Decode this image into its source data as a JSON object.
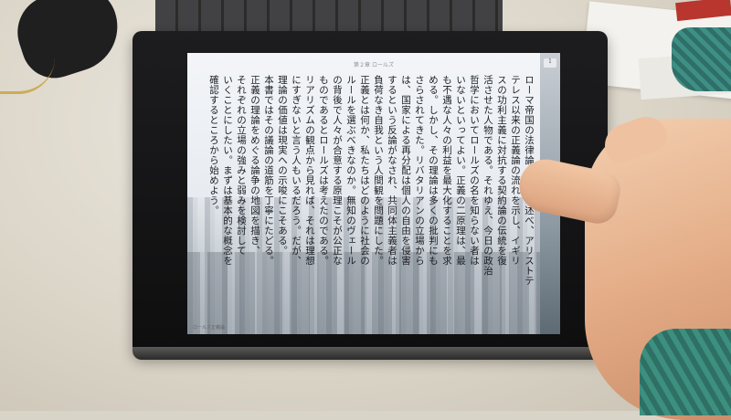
{
  "scene": {
    "description_objects": [
      "tablet",
      "keyboard",
      "mouse",
      "hand"
    ]
  },
  "tablet": {
    "header": "第２章 ロールズ",
    "page_counter": "1",
    "footer": "ロールズ正義論",
    "columns": [
      "ローマ帝国の法律論の歴史を述べ、アリストテ",
      "テレス以来の正義論の流れを示し、イギリ",
      "スの功利主義に対抗する契約論の伝統を復",
      "活させた人物である。それゆえ、今日の政治",
      "哲学においてロールズの名を知らない者は",
      "いないといってよい。正義の二原理は、最",
      "も不遇な人々の利益を最大化することを求",
      "める。しかし、その理論は多くの批判にも",
      "さらされてきた。リバタリアンの立場から",
      "は、国家による再分配は個人の自由を侵害",
      "するという反論がなされ、共同体主義者は",
      "負荷なき自我という人間観を問題にした。",
      "正義とは何か、私たちはどのように社会の",
      "ルールを選ぶべきなのか。無知のヴェール",
      "の背後で人々が合意する原理こそが公正な",
      "ものであるとロールズは考えたのである。",
      "リアリズムの観点から見れば、それは理想",
      "にすぎないと言う人もいるだろう。だが、",
      "理論の価値は現実への示唆にこそある。",
      "本書ではその議論の道筋を丁寧にたどる。",
      "正義の理論をめぐる論争の地図を描き、",
      "それぞれの立場の強みと弱みを検討して",
      "いくことにしたい。まずは基本的な概念を",
      "確認するところから始めよう。"
    ]
  },
  "colors": {
    "screen_bg": "#eef1f5",
    "text": "#1c1f24",
    "bezel": "#141415",
    "skin": "#e8b692",
    "sweater": "#3d8f7f"
  }
}
